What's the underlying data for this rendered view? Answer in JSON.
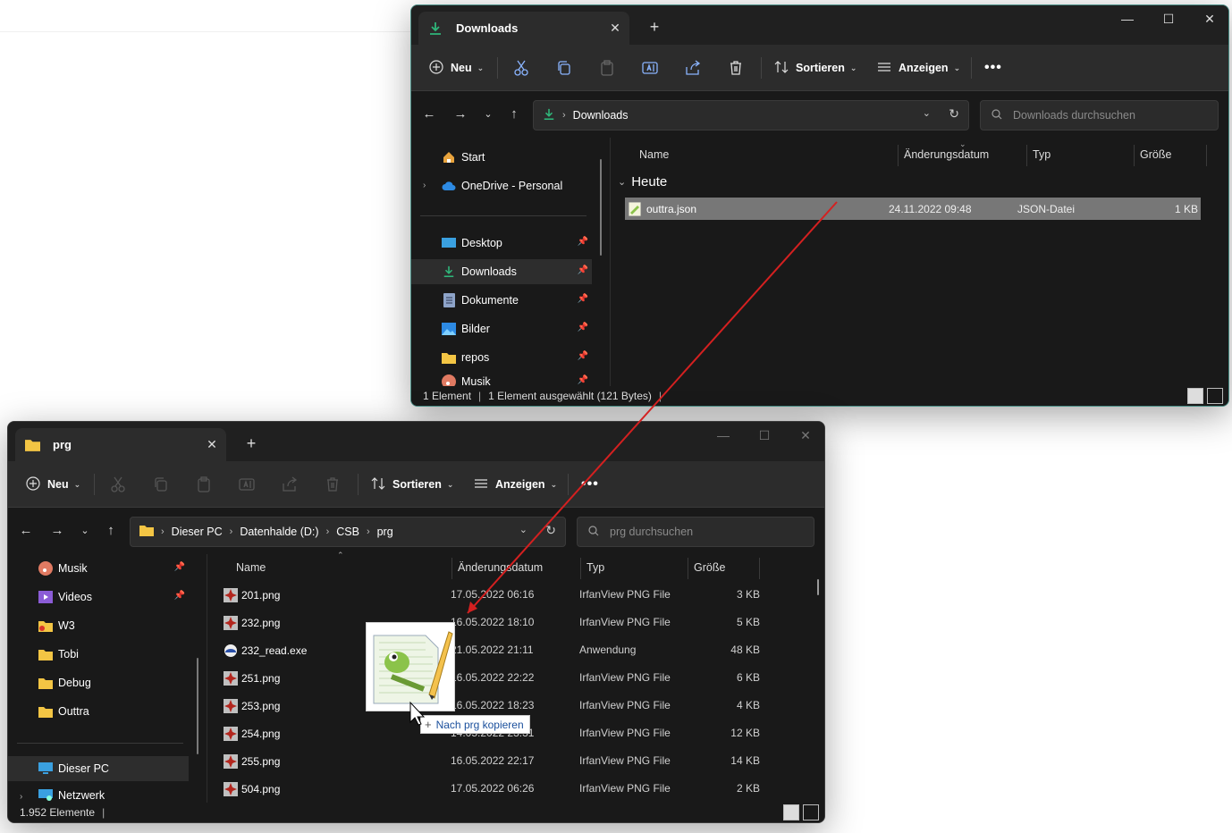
{
  "downloads_window": {
    "tab_title": "Downloads",
    "toolbar": {
      "new": "Neu",
      "sort": "Sortieren",
      "view": "Anzeigen"
    },
    "breadcrumb": [
      "Downloads"
    ],
    "search_placeholder": "Downloads durchsuchen",
    "nav": [
      {
        "label": "Start",
        "icon": "home-icon"
      },
      {
        "label": "OneDrive - Personal",
        "icon": "cloud-icon"
      },
      {
        "label": "Desktop",
        "icon": "desktop-icon"
      },
      {
        "label": "Downloads",
        "icon": "download-icon",
        "selected": true
      },
      {
        "label": "Dokumente",
        "icon": "document-icon"
      },
      {
        "label": "Bilder",
        "icon": "picture-icon"
      },
      {
        "label": "repos",
        "icon": "folder-icon"
      },
      {
        "label": "Musik",
        "icon": "music-icon"
      }
    ],
    "columns": [
      "Name",
      "Änderungsdatum",
      "Typ",
      "Größe"
    ],
    "group": "Heute",
    "files": [
      {
        "name": "outtra.json",
        "date": "24.11.2022 09:48",
        "type": "JSON-Datei",
        "size": "1 KB",
        "selected": true
      }
    ],
    "status": {
      "count": "1 Element",
      "selection": "1 Element ausgewählt (121 Bytes)"
    }
  },
  "prg_window": {
    "tab_title": "prg",
    "toolbar": {
      "new": "Neu",
      "sort": "Sortieren",
      "view": "Anzeigen"
    },
    "breadcrumb": [
      "Dieser PC",
      "Datenhalde (D:)",
      "CSB",
      "prg"
    ],
    "search_placeholder": "prg durchsuchen",
    "nav": [
      {
        "label": "Musik",
        "icon": "music-icon",
        "pinned": true
      },
      {
        "label": "Videos",
        "icon": "video-icon",
        "pinned": true
      },
      {
        "label": "W3",
        "icon": "folder-icon"
      },
      {
        "label": "Tobi",
        "icon": "folder-icon"
      },
      {
        "label": "Debug",
        "icon": "folder-icon"
      },
      {
        "label": "Outtra",
        "icon": "folder-icon"
      },
      {
        "label": "Dieser PC",
        "icon": "computer-icon",
        "selected": true
      },
      {
        "label": "Netzwerk",
        "icon": "network-icon"
      }
    ],
    "columns": [
      "Name",
      "Änderungsdatum",
      "Typ",
      "Größe"
    ],
    "files": [
      {
        "name": "201.png",
        "date": "17.05.2022 06:16",
        "type": "IrfanView PNG File",
        "size": "3 KB"
      },
      {
        "name": "232.png",
        "date": "16.05.2022 18:10",
        "type": "IrfanView PNG File",
        "size": "5 KB"
      },
      {
        "name": "232_read.exe",
        "date": "21.05.2022 21:11",
        "type": "Anwendung",
        "size": "48 KB"
      },
      {
        "name": "251.png",
        "date": "16.05.2022 22:22",
        "type": "IrfanView PNG File",
        "size": "6 KB"
      },
      {
        "name": "253.png",
        "date": "16.05.2022 18:23",
        "type": "IrfanView PNG File",
        "size": "4 KB"
      },
      {
        "name": "254.png",
        "date": "14.05.2022 23:31",
        "type": "IrfanView PNG File",
        "size": "12 KB"
      },
      {
        "name": "255.png",
        "date": "16.05.2022 22:17",
        "type": "IrfanView PNG File",
        "size": "14 KB"
      },
      {
        "name": "504.png",
        "date": "17.05.2022 06:26",
        "type": "IrfanView PNG File",
        "size": "2 KB"
      }
    ],
    "status": {
      "count": "1.952 Elemente"
    }
  },
  "drag": {
    "tooltip": "Nach prg kopieren",
    "tooltip_icon": "+"
  },
  "colors": {
    "accent_download": "#2fb67a",
    "folder": "#f3c544",
    "arrow": "#d42020",
    "border_active": "#4a8e86"
  }
}
